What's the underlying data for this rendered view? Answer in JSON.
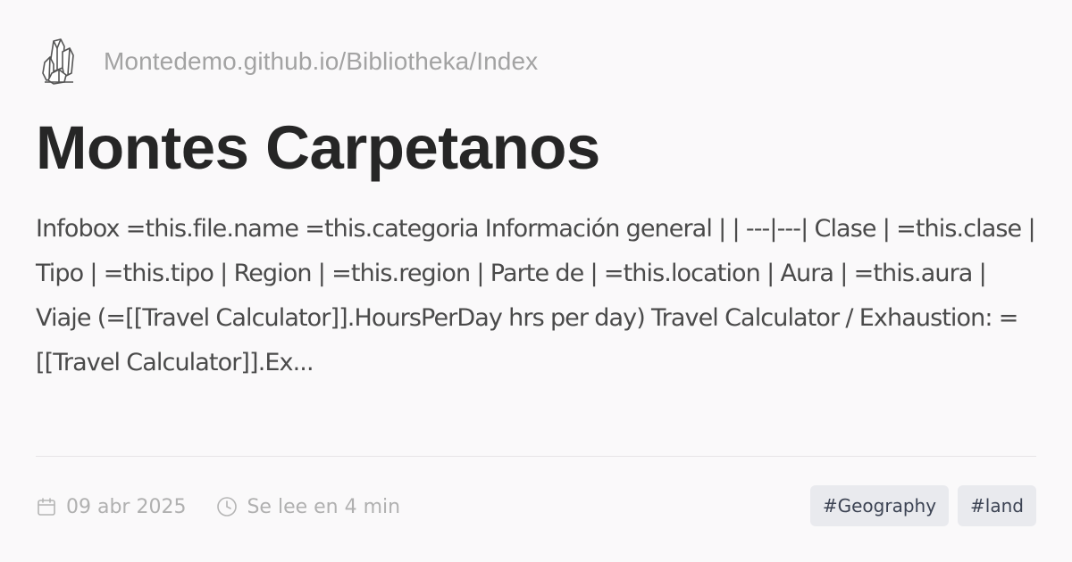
{
  "site": {
    "url": "Montedemo.github.io/Bibliotheka/Index",
    "logo_icon": "crystal-cluster-icon"
  },
  "page": {
    "title": "Montes Carpetanos",
    "excerpt": "Infobox =this.file.name =this.categoria Información general | | ---|---| Clase | =this.clase | Tipo | =this.tipo | Region | =this.region | Parte de | =this.location | Aura | =this.aura | Viaje (=[[Travel Calculator]].HoursPerDay hrs per day) Travel Calculator / Exhaustion: =[[Travel Calculator]].Ex..."
  },
  "meta": {
    "date": "09 abr 2025",
    "date_icon": "calendar-icon",
    "reading_time": "Se lee en 4 min",
    "reading_time_icon": "clock-icon"
  },
  "tags": [
    {
      "label": "#Geography"
    },
    {
      "label": "#land"
    }
  ],
  "colors": {
    "background": "#faf9fa",
    "title": "#262626",
    "muted_text": "#a3a3a3",
    "tag_background": "#e9eaee",
    "tag_text": "#3c4353"
  }
}
